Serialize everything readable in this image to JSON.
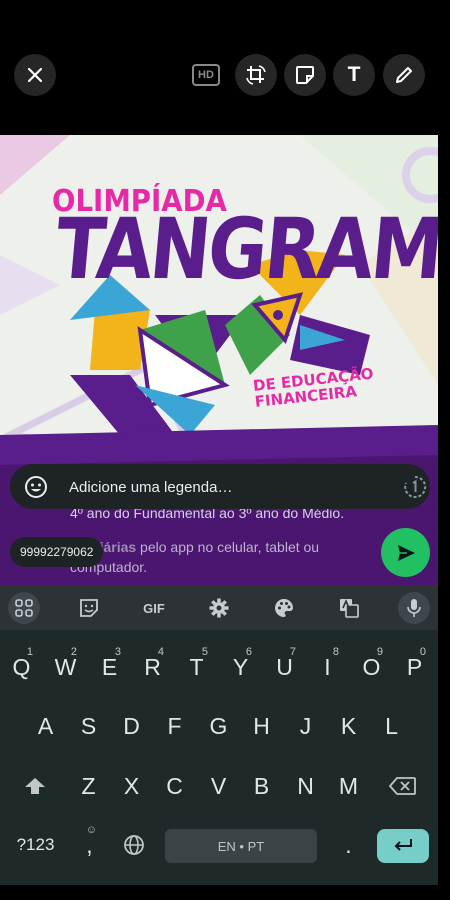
{
  "topbar": {
    "close_icon": "close-icon",
    "hd_label": "HD",
    "tools": [
      "crop-rotate-icon",
      "sticker-icon",
      "text-icon",
      "pencil-icon"
    ],
    "text_tool_label": "T"
  },
  "preview": {
    "logo_line1": "OLIMPÍADA",
    "logo_line2": "TANGRAM",
    "logo_line3": "DE EDUCAÇÃO",
    "logo_line4": "FINANCEIRA",
    "promo_line1": "4º ano do Fundamental ao 3º ano do Médio.",
    "promo_bold": "es Diárias",
    "promo_line2_rest": " pelo app no celular, tablet ou",
    "promo_line3": "computador.",
    "colors": {
      "purple": "#5a1d8c",
      "magenta": "#e62aa7",
      "yellow": "#f2b31b",
      "green": "#3fa24a",
      "blue": "#3ba5d6"
    }
  },
  "caption": {
    "placeholder": "Adicione uma legenda…"
  },
  "recipient": "99992279062",
  "send_color": "#21c063",
  "keyboard": {
    "toolbar": {
      "gif_label": "GIF"
    },
    "row1": [
      "Q",
      "W",
      "E",
      "R",
      "T",
      "Y",
      "U",
      "I",
      "O",
      "P"
    ],
    "row1_digits": [
      "1",
      "2",
      "3",
      "4",
      "5",
      "6",
      "7",
      "8",
      "9",
      "0"
    ],
    "row2": [
      "A",
      "S",
      "D",
      "F",
      "G",
      "H",
      "J",
      "K",
      "L"
    ],
    "row3": [
      "Z",
      "X",
      "C",
      "V",
      "B",
      "N",
      "M"
    ],
    "symbols_label": "?123",
    "comma": ",",
    "comma_hint": "☺",
    "space_label": "EN • PT",
    "period": ".",
    "enter_color": "#77cdc8"
  }
}
